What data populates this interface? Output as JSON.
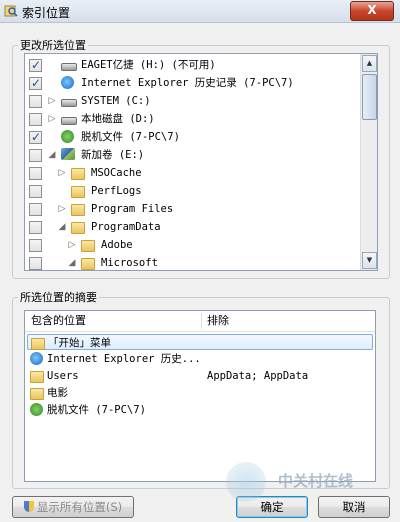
{
  "window": {
    "title": "索引位置",
    "close_label": "X"
  },
  "change_locations": {
    "group_label": "更改所选位置",
    "items": [
      {
        "label": "EAGET亿捷 (H:) (不可用)",
        "checked": true,
        "expand": ""
      },
      {
        "label": "Internet Explorer 历史记录 (7-PC\\7)",
        "checked": true,
        "expand": ""
      },
      {
        "label": "SYSTEM (C:)",
        "checked": false,
        "expand": "▷"
      },
      {
        "label": "本地磁盘 (D:)",
        "checked": false,
        "expand": "▷"
      },
      {
        "label": "脱机文件 (7-PC\\7)",
        "checked": true,
        "expand": ""
      },
      {
        "label": "新加卷 (E:)",
        "checked": false,
        "expand": "◢"
      },
      {
        "label": "MSOCache",
        "checked": false,
        "expand": "▷"
      },
      {
        "label": "PerfLogs",
        "checked": false,
        "expand": ""
      },
      {
        "label": "Program Files",
        "checked": false,
        "expand": "▷"
      },
      {
        "label": "ProgramData",
        "checked": false,
        "expand": "◢"
      },
      {
        "label": "Adobe",
        "checked": false,
        "expand": "▷"
      },
      {
        "label": "Microsoft",
        "checked": false,
        "expand": "◢"
      }
    ]
  },
  "summary": {
    "group_label": "所选位置的摘要",
    "col_included": "包含的位置",
    "col_excluded": "排除",
    "rows": [
      {
        "location": "「开始」菜单",
        "exclude": ""
      },
      {
        "location": "Internet Explorer 历史...",
        "exclude": ""
      },
      {
        "location": "Users",
        "exclude": "AppData; AppData"
      },
      {
        "location": "电影",
        "exclude": ""
      },
      {
        "location": "脱机文件 (7-PC\\7)",
        "exclude": ""
      }
    ]
  },
  "buttons": {
    "show_all": "显示所有位置(S)",
    "ok": "确定",
    "cancel": "取消"
  },
  "watermark": "中关村在线"
}
